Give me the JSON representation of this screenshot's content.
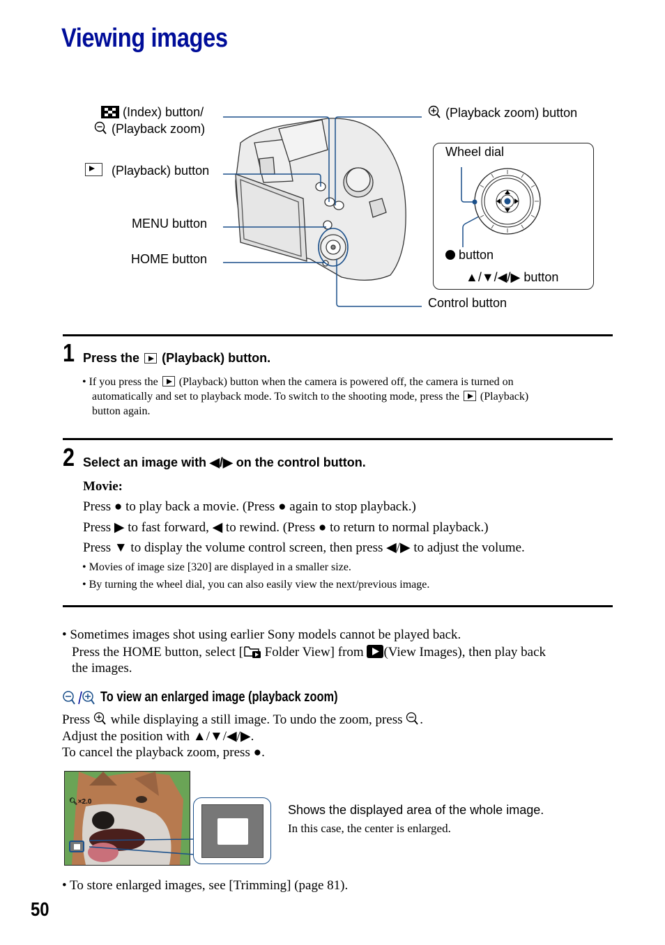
{
  "page": {
    "title": "Viewing images",
    "page_number": "50"
  },
  "diagram": {
    "labels": {
      "index_button": "(Index) button/",
      "playback_zoom_out": "(Playback zoom)",
      "playback_button": "(Playback) button",
      "menu_button": "MENU button",
      "home_button": "HOME button",
      "playback_zoom_in": "(Playback zoom) button",
      "wheel_dial": "Wheel dial",
      "center_button": "button",
      "arrow_buttons": "▲/▼/◀/▶ button",
      "control_button": "Control button"
    },
    "icons": [
      "index-icon",
      "zoom-out-icon",
      "playback-icon",
      "zoom-in-icon",
      "bullet-icon"
    ],
    "accent_color": "#1a4f8a"
  },
  "step1": {
    "number": "1",
    "heading_pre": "Press the",
    "heading_post": "(Playback) button.",
    "note_parts": [
      "• If you press the",
      "(Playback) button when the camera is powered off, the camera is turned on",
      "automatically and set to playback mode. To switch to the shooting mode, press the",
      "(Playback)",
      "button again."
    ]
  },
  "step2": {
    "number": "2",
    "heading": "Select an image with ◀/▶ on the control button.",
    "movie_label": "Movie:",
    "lines": [
      "Press ● to play back a movie. (Press ● again to stop playback.)",
      "Press ▶ to fast forward, ◀ to rewind. (Press ● to return to normal playback.)",
      "Press ▼ to display the volume control screen, then press ◀/▶ to adjust the volume."
    ],
    "notes": [
      "• Movies of image size [320] are displayed in a smaller size.",
      "• By turning the wheel dial, you can also easily view the next/previous image."
    ]
  },
  "note_sony": {
    "line1": "• Sometimes images shot using earlier Sony models cannot be played back.",
    "line2_a": "Press the HOME button, select [",
    "line2_b": "Folder View] from",
    "line2_c": "(View Images), then play back",
    "line3": "the images."
  },
  "zoom_section": {
    "heading": "To view an enlarged image (playback zoom)",
    "line1_a": "Press",
    "line1_b": "while displaying a still image. To undo the zoom, press",
    "line1_c": ".",
    "line2": "Adjust the position with ▲/▼/◀/▶.",
    "line3": "To cancel the playback zoom, press ●.",
    "zoom_readout": "×2.0",
    "caption1": "Shows the displayed area of the whole image.",
    "caption2": "In this case, the center is enlarged.",
    "trimming_note": "• To store enlarged images, see [Trimming] (page 81)."
  }
}
